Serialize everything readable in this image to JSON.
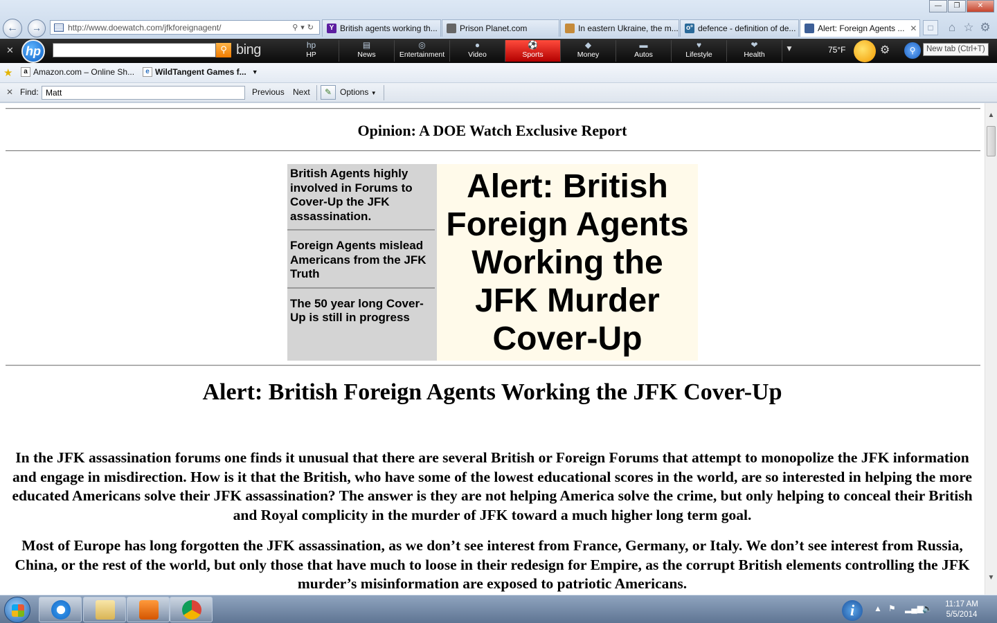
{
  "browser": {
    "address": {
      "url": "http://www.doewatch.com/jfkforeignagent/"
    },
    "tabs": [
      {
        "label": "British agents working th...",
        "fav_text": "Y",
        "fav_color": "#5c1fa0"
      },
      {
        "label": "Prison Planet.com",
        "fav_text": "",
        "fav_color": "#666666"
      },
      {
        "label": "In eastern Ukraine, the m...",
        "fav_text": "",
        "fav_color": "#c58a3a"
      },
      {
        "label": "defence - definition of de...",
        "fav_text": "o°",
        "fav_color": "#2a6a9a"
      },
      {
        "label": "Alert: Foreign Agents ...",
        "fav_text": "",
        "fav_color": "#3d5f97",
        "active": true
      }
    ],
    "tooltip": "New tab (Ctrl+T)"
  },
  "hp_toolbar": {
    "bing": "bing",
    "items": [
      {
        "label": "HP",
        "glyph": "hp"
      },
      {
        "label": "News",
        "glyph": "▤"
      },
      {
        "label": "Entertainment",
        "glyph": "◎"
      },
      {
        "label": "Video",
        "glyph": "●"
      },
      {
        "label": "Sports",
        "glyph": "⚽",
        "active": true
      },
      {
        "label": "Money",
        "glyph": "◆"
      },
      {
        "label": "Autos",
        "glyph": "▬"
      },
      {
        "label": "Lifestyle",
        "glyph": "♥"
      },
      {
        "label": "Health",
        "glyph": "❤"
      }
    ],
    "temperature": "75°F"
  },
  "favorites": [
    {
      "label": "Amazon.com – Online Sh...",
      "icon": "a"
    },
    {
      "label": "WildTangent Games f...",
      "icon": "e"
    }
  ],
  "find_bar": {
    "label": "Find:",
    "value": "Matt",
    "previous": "Previous",
    "next": "Next",
    "options": "Options"
  },
  "page": {
    "opinion": "Opinion: A DOE Watch Exclusive Report",
    "sidebar": [
      "British Agents highly involved in Forums to Cover-Up the JFK assassination.",
      "Foreign Agents mislead Americans from the JFK Truth",
      "The 50 year long Cover-Up is still in progress"
    ],
    "banner": "Alert: British Foreign Agents Working the JFK Murder Cover-Up",
    "heading": "Alert:  British Foreign Agents Working the JFK Cover-Up",
    "paragraphs": [
      "In the JFK assassination forums one finds it unusual that there are several British or Foreign Forums that attempt to monopolize the JFK information and engage in misdirection.  How is it that the British, who have some of the lowest educational scores in the world, are so interested in helping the more educated Americans solve their JFK assassination?   The answer is they are not helping America solve the crime, but only helping to conceal their British and Royal complicity in the murder of JFK toward a much higher long term goal.",
      "Most of Europe has long forgotten the JFK assassination, as we don’t see interest from France, Germany, or Italy.   We don’t see interest from Russia, China, or the rest of the world, but only those that have much to loose in their redesign for Empire, as the corrupt British elements controlling the JFK murder’s misinformation are exposed to patriotic Americans."
    ]
  },
  "taskbar": {
    "clock_time": "11:17 AM",
    "clock_date": "5/5/2014"
  }
}
